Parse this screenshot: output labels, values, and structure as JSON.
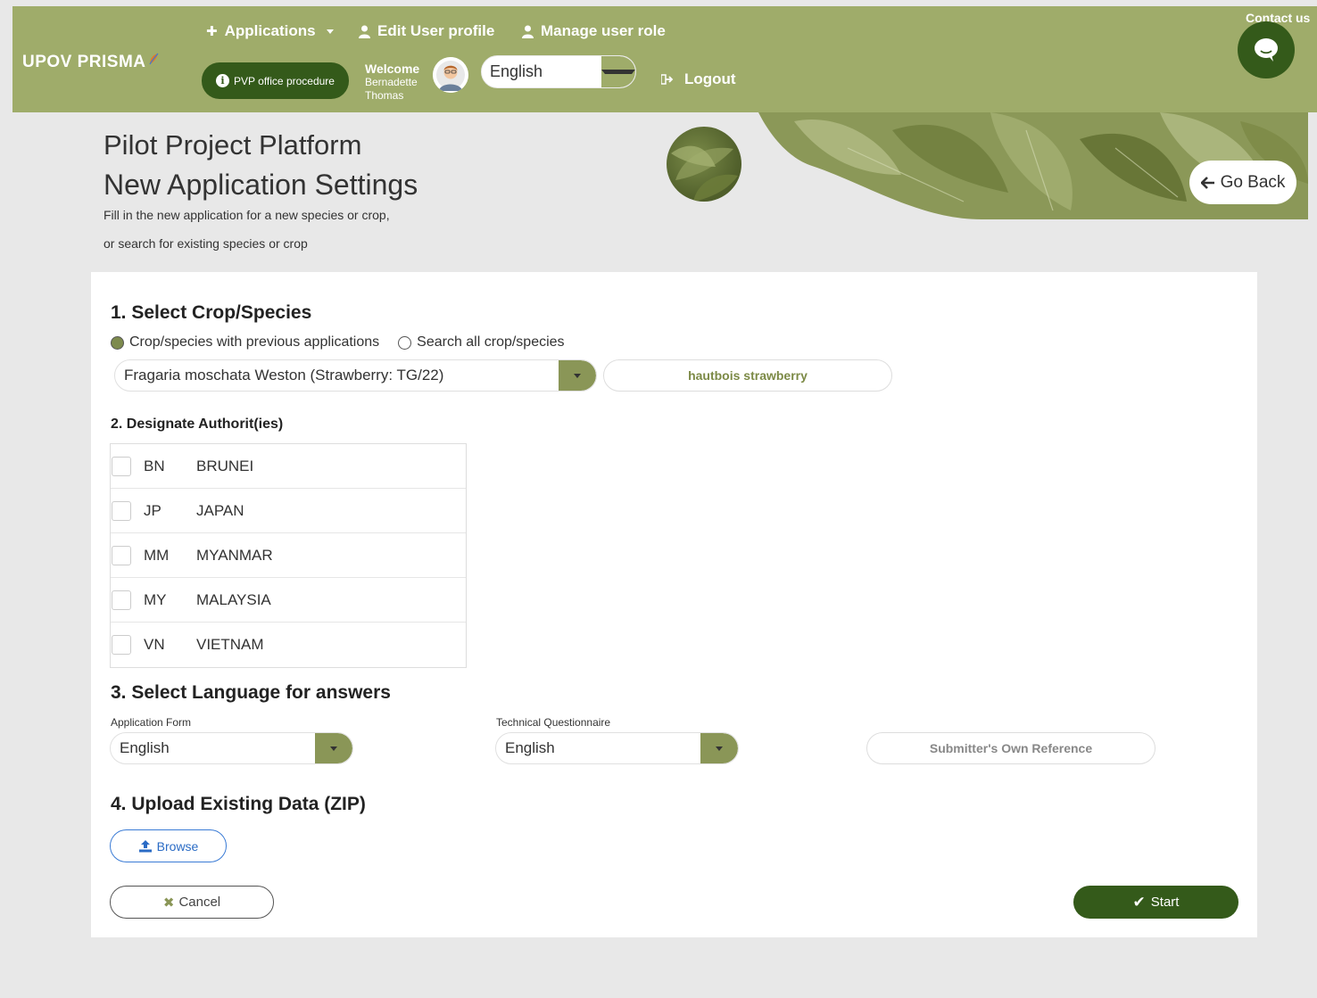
{
  "nav": {
    "logo": "UPOV PRISMA",
    "applications": "Applications",
    "edit_profile": "Edit User profile",
    "manage_role": "Manage user role",
    "pvp_procedure": "PVP office procedure",
    "welcome": "Welcome",
    "user_first": "Bernadette",
    "user_last": "Thomas",
    "language": "English",
    "logout": "Logout",
    "contact": "Contact us"
  },
  "header": {
    "title": "Pilot Project Platform",
    "subtitle": "New Application Settings",
    "desc_line1": "Fill in the new application for a new species or crop,",
    "desc_line2": "or search for existing species or crop",
    "go_back": "Go Back"
  },
  "section1": {
    "heading": "1. Select Crop/Species",
    "radio_previous": "Crop/species with previous applications",
    "radio_all": "Search all crop/species",
    "selected_crop": "Fragaria moschata Weston (Strawberry: TG/22)",
    "common_name": "hautbois strawberry"
  },
  "section2": {
    "heading": "2. Designate Authorit(ies)",
    "authorities": [
      {
        "code": "BN",
        "name": "BRUNEI"
      },
      {
        "code": "JP",
        "name": "JAPAN"
      },
      {
        "code": "MM",
        "name": "MYANMAR"
      },
      {
        "code": "MY",
        "name": "MALAYSIA"
      },
      {
        "code": "VN",
        "name": "VIETNAM"
      }
    ]
  },
  "section3": {
    "heading": "3. Select Language for answers",
    "app_form_label": "Application Form",
    "app_form_value": "English",
    "tq_label": "Technical Questionnaire",
    "tq_value": "English",
    "reference_placeholder": "Submitter's Own Reference"
  },
  "section4": {
    "heading": "4. Upload Existing Data (ZIP)",
    "browse": "Browse"
  },
  "actions": {
    "cancel": "Cancel",
    "start": "Start"
  },
  "colors": {
    "nav_bg": "#9fac6a",
    "primary_dark": "#345a1a",
    "dropdown": "#8a9657",
    "link_blue": "#2a6bc5"
  }
}
